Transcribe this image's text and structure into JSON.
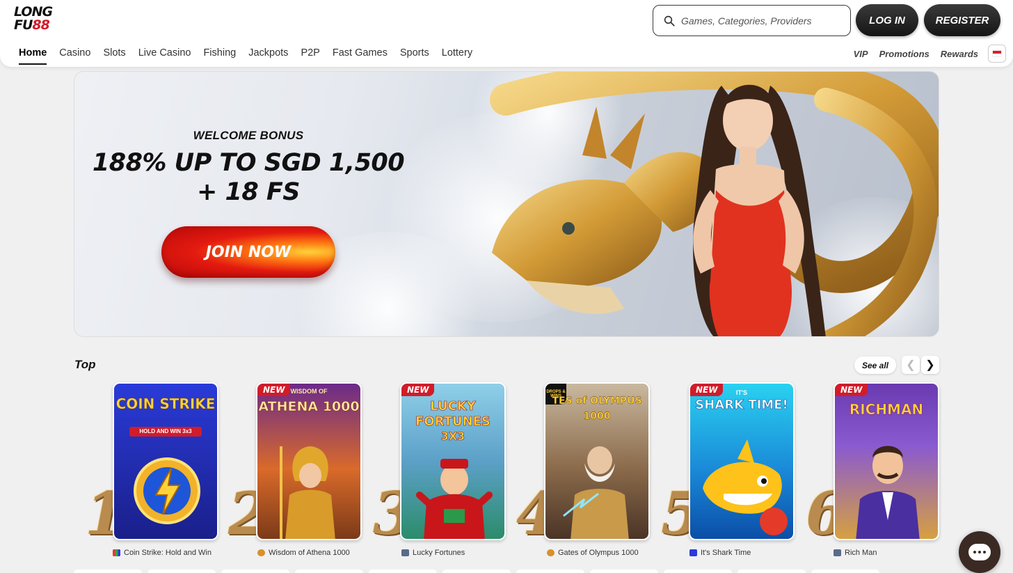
{
  "brand": {
    "line1": "LONG",
    "line2a": "FU",
    "line2b": "88"
  },
  "search": {
    "placeholder": "Games, Categories, Providers"
  },
  "auth": {
    "login": "LOG IN",
    "register": "REGISTER"
  },
  "nav": {
    "items": [
      "Home",
      "Casino",
      "Slots",
      "Live Casino",
      "Fishing",
      "Jackpots",
      "P2P",
      "Fast Games",
      "Sports",
      "Lottery"
    ],
    "active": "Home",
    "right": [
      "VIP",
      "Promotions",
      "Rewards"
    ]
  },
  "banner": {
    "subtitle": "WELCOME BONUS",
    "headline_1": "188% UP TO SGD 1,500",
    "headline_2": "+ 18 FS",
    "cta": "JOIN NOW"
  },
  "top": {
    "title": "Top",
    "see_all": "See all",
    "games": [
      {
        "rank": "1",
        "name": "Coin Strike: Hold and Win",
        "card_title": "COIN STRIKE",
        "card_sub": "HOLD AND WIN 3x3",
        "new": false
      },
      {
        "rank": "2",
        "name": "Wisdom of Athena 1000",
        "card_title": "ATHENA 1000",
        "card_sub": "WISDOM OF",
        "new": true
      },
      {
        "rank": "3",
        "name": "Lucky Fortunes",
        "card_title": "LUCKY FORTUNES",
        "card_sub": "3X3",
        "new": true
      },
      {
        "rank": "4",
        "name": "Gates of Olympus 1000",
        "card_title": "TES of OLYMPUS 1000",
        "card_sub": "DROPS & WINS",
        "new": false
      },
      {
        "rank": "5",
        "name": "It's Shark Time",
        "card_title": "SHARK TIME!",
        "card_sub": "IT'S",
        "new": true
      },
      {
        "rank": "6",
        "name": "Rich Man",
        "card_title": "RICHMAN",
        "card_sub": "",
        "new": true
      }
    ],
    "new_badge": "NEW"
  },
  "colors": {
    "accent_red": "#d11c2a",
    "dark_button": "#1a1a1a",
    "page_bg": "#f0f0f1"
  }
}
